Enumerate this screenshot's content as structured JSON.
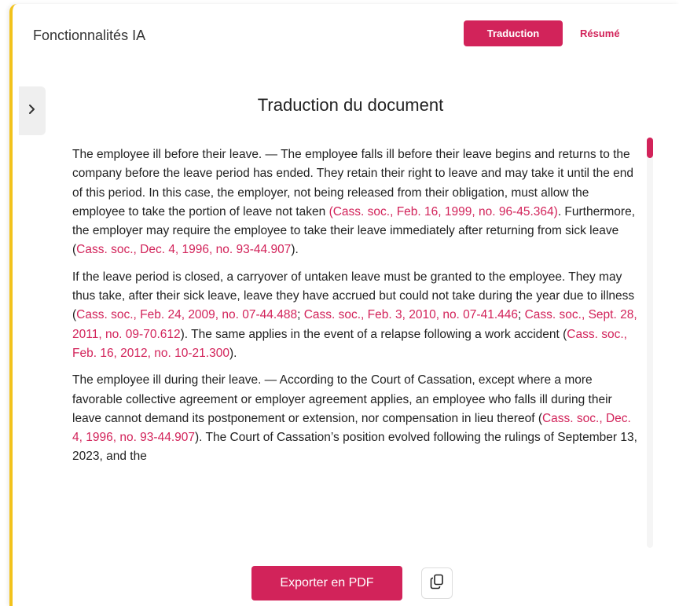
{
  "header": {
    "title": "Fonctionnalités IA",
    "translate_label": "Traduction",
    "summary_label": "Résumé"
  },
  "section": {
    "title": "Traduction du document"
  },
  "paragraphs": [
    {
      "segments": [
        {
          "text": "The employee ill before their leave. — The employee falls ill before their leave begins and returns to the company before the leave period has ended. They retain their right to leave and may take it until the end of this period. In this case, the employer, not being released from their obligation, must allow the employee to take the portion of leave not taken ",
          "ref": false
        },
        {
          "text": "(Cass. soc., Feb. 16, 1999, no. 96-45.364)",
          "ref": true
        },
        {
          "text": ". Furthermore, the employer may require the employee to take their leave immediately after returning from sick leave (",
          "ref": false
        },
        {
          "text": "Cass. soc., Dec. 4, 1996, no. 93-44.907",
          "ref": true
        },
        {
          "text": ").",
          "ref": false
        }
      ]
    },
    {
      "segments": [
        {
          "text": "If the leave period is closed, a carryover of untaken leave must be granted to the employee. They may thus take, after their sick leave, leave they have accrued but could not take during the year due to illness (",
          "ref": false
        },
        {
          "text": "Cass. soc., Feb. 24, 2009, no. 07-44.488",
          "ref": true
        },
        {
          "text": "; ",
          "ref": false
        },
        {
          "text": "Cass. soc., Feb. 3, 2010, no. 07-41.446",
          "ref": true
        },
        {
          "text": "; ",
          "ref": false
        },
        {
          "text": "Cass. soc., Sept. 28, 2011, no. 09-70.612",
          "ref": true
        },
        {
          "text": "). The same applies in the event of a relapse following a work accident (",
          "ref": false
        },
        {
          "text": "Cass. soc., Feb. 16, 2012, no. 10-21.300",
          "ref": true
        },
        {
          "text": ").",
          "ref": false
        }
      ]
    },
    {
      "segments": [
        {
          "text": "The employee ill during their leave. — According to the Court of Cassation, except where a more favorable collective agreement or employer agreement applies, an employee who falls ill during their leave cannot demand its postponement or extension, nor compensation in lieu thereof (",
          "ref": false
        },
        {
          "text": "Cass. soc., Dec. 4, 1996, no. 93-44.907",
          "ref": true
        },
        {
          "text": "). The Court of Cassation’s position evolved following the rulings of September 13, 2023, and the",
          "ref": false
        }
      ]
    }
  ],
  "footer": {
    "export_label": "Exporter en PDF"
  },
  "icons": {
    "collapse": "chevron-right-icon",
    "copy": "copy-icon"
  },
  "colors": {
    "accent": "#d2235a",
    "panel_border": "#f2c21b"
  }
}
